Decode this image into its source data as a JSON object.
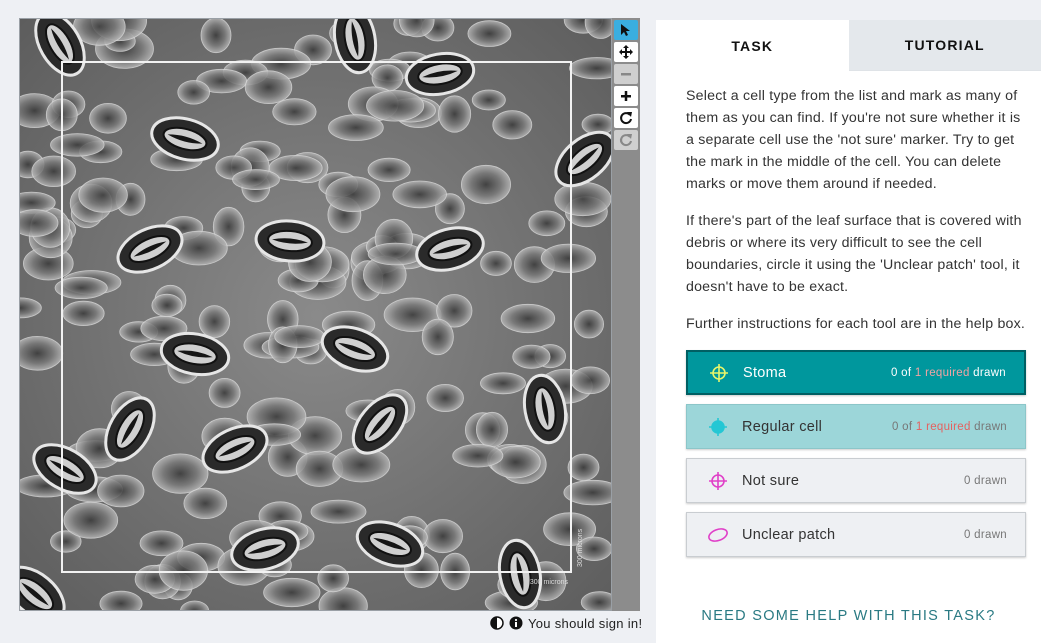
{
  "viewer": {
    "scale_label_bottom": "300 microns",
    "scale_label_side": "300 microns",
    "icons": [
      "pointer-icon",
      "move-icon",
      "zoom-out-icon",
      "zoom-in-icon",
      "rotate-icon",
      "reset-icon"
    ]
  },
  "footer": {
    "signin_text": "You should sign in!",
    "icons": [
      "contrast-icon",
      "info-icon"
    ]
  },
  "tabs": {
    "task": "TASK",
    "tutorial": "TUTORIAL"
  },
  "instructions": {
    "p1": "Select a cell type from the list and mark as many of them as you can find. If you're not sure whether it is a separate cell use the 'not sure' marker. Try to get the mark in the middle of the cell. You can delete marks or move them around if needed.",
    "p2": "If there's part of the leaf surface that is covered with debris or where its very difficult to see the cell boundaries, circle it using the 'Unclear patch' tool, it doesn't have to be exact.",
    "p3": "Further instructions for each tool are in the help box."
  },
  "tools": [
    {
      "label": "Stoma",
      "count_prefix": "0 of ",
      "required": "1 required",
      "count_suffix": " drawn",
      "color": "#e8f56a",
      "icon": "crosshair-icon"
    },
    {
      "label": "Regular cell",
      "count_prefix": "0 of ",
      "required": "1 required",
      "count_suffix": " drawn",
      "color": "#25c7d4",
      "icon": "crosshair-icon"
    },
    {
      "label": "Not sure",
      "count": "0 drawn",
      "color": "#e040c8",
      "icon": "crosshair-icon"
    },
    {
      "label": "Unclear patch",
      "count": "0 drawn",
      "color": "#e040c8",
      "icon": "ellipse-icon"
    }
  ],
  "help_link": "NEED SOME HELP WITH THIS TASK?",
  "colors": {
    "accent": "#00979d",
    "regular": "#9cd6d9",
    "required": "#e4605f",
    "help": "#2a7a83",
    "active_tool": "#3aaee0"
  }
}
